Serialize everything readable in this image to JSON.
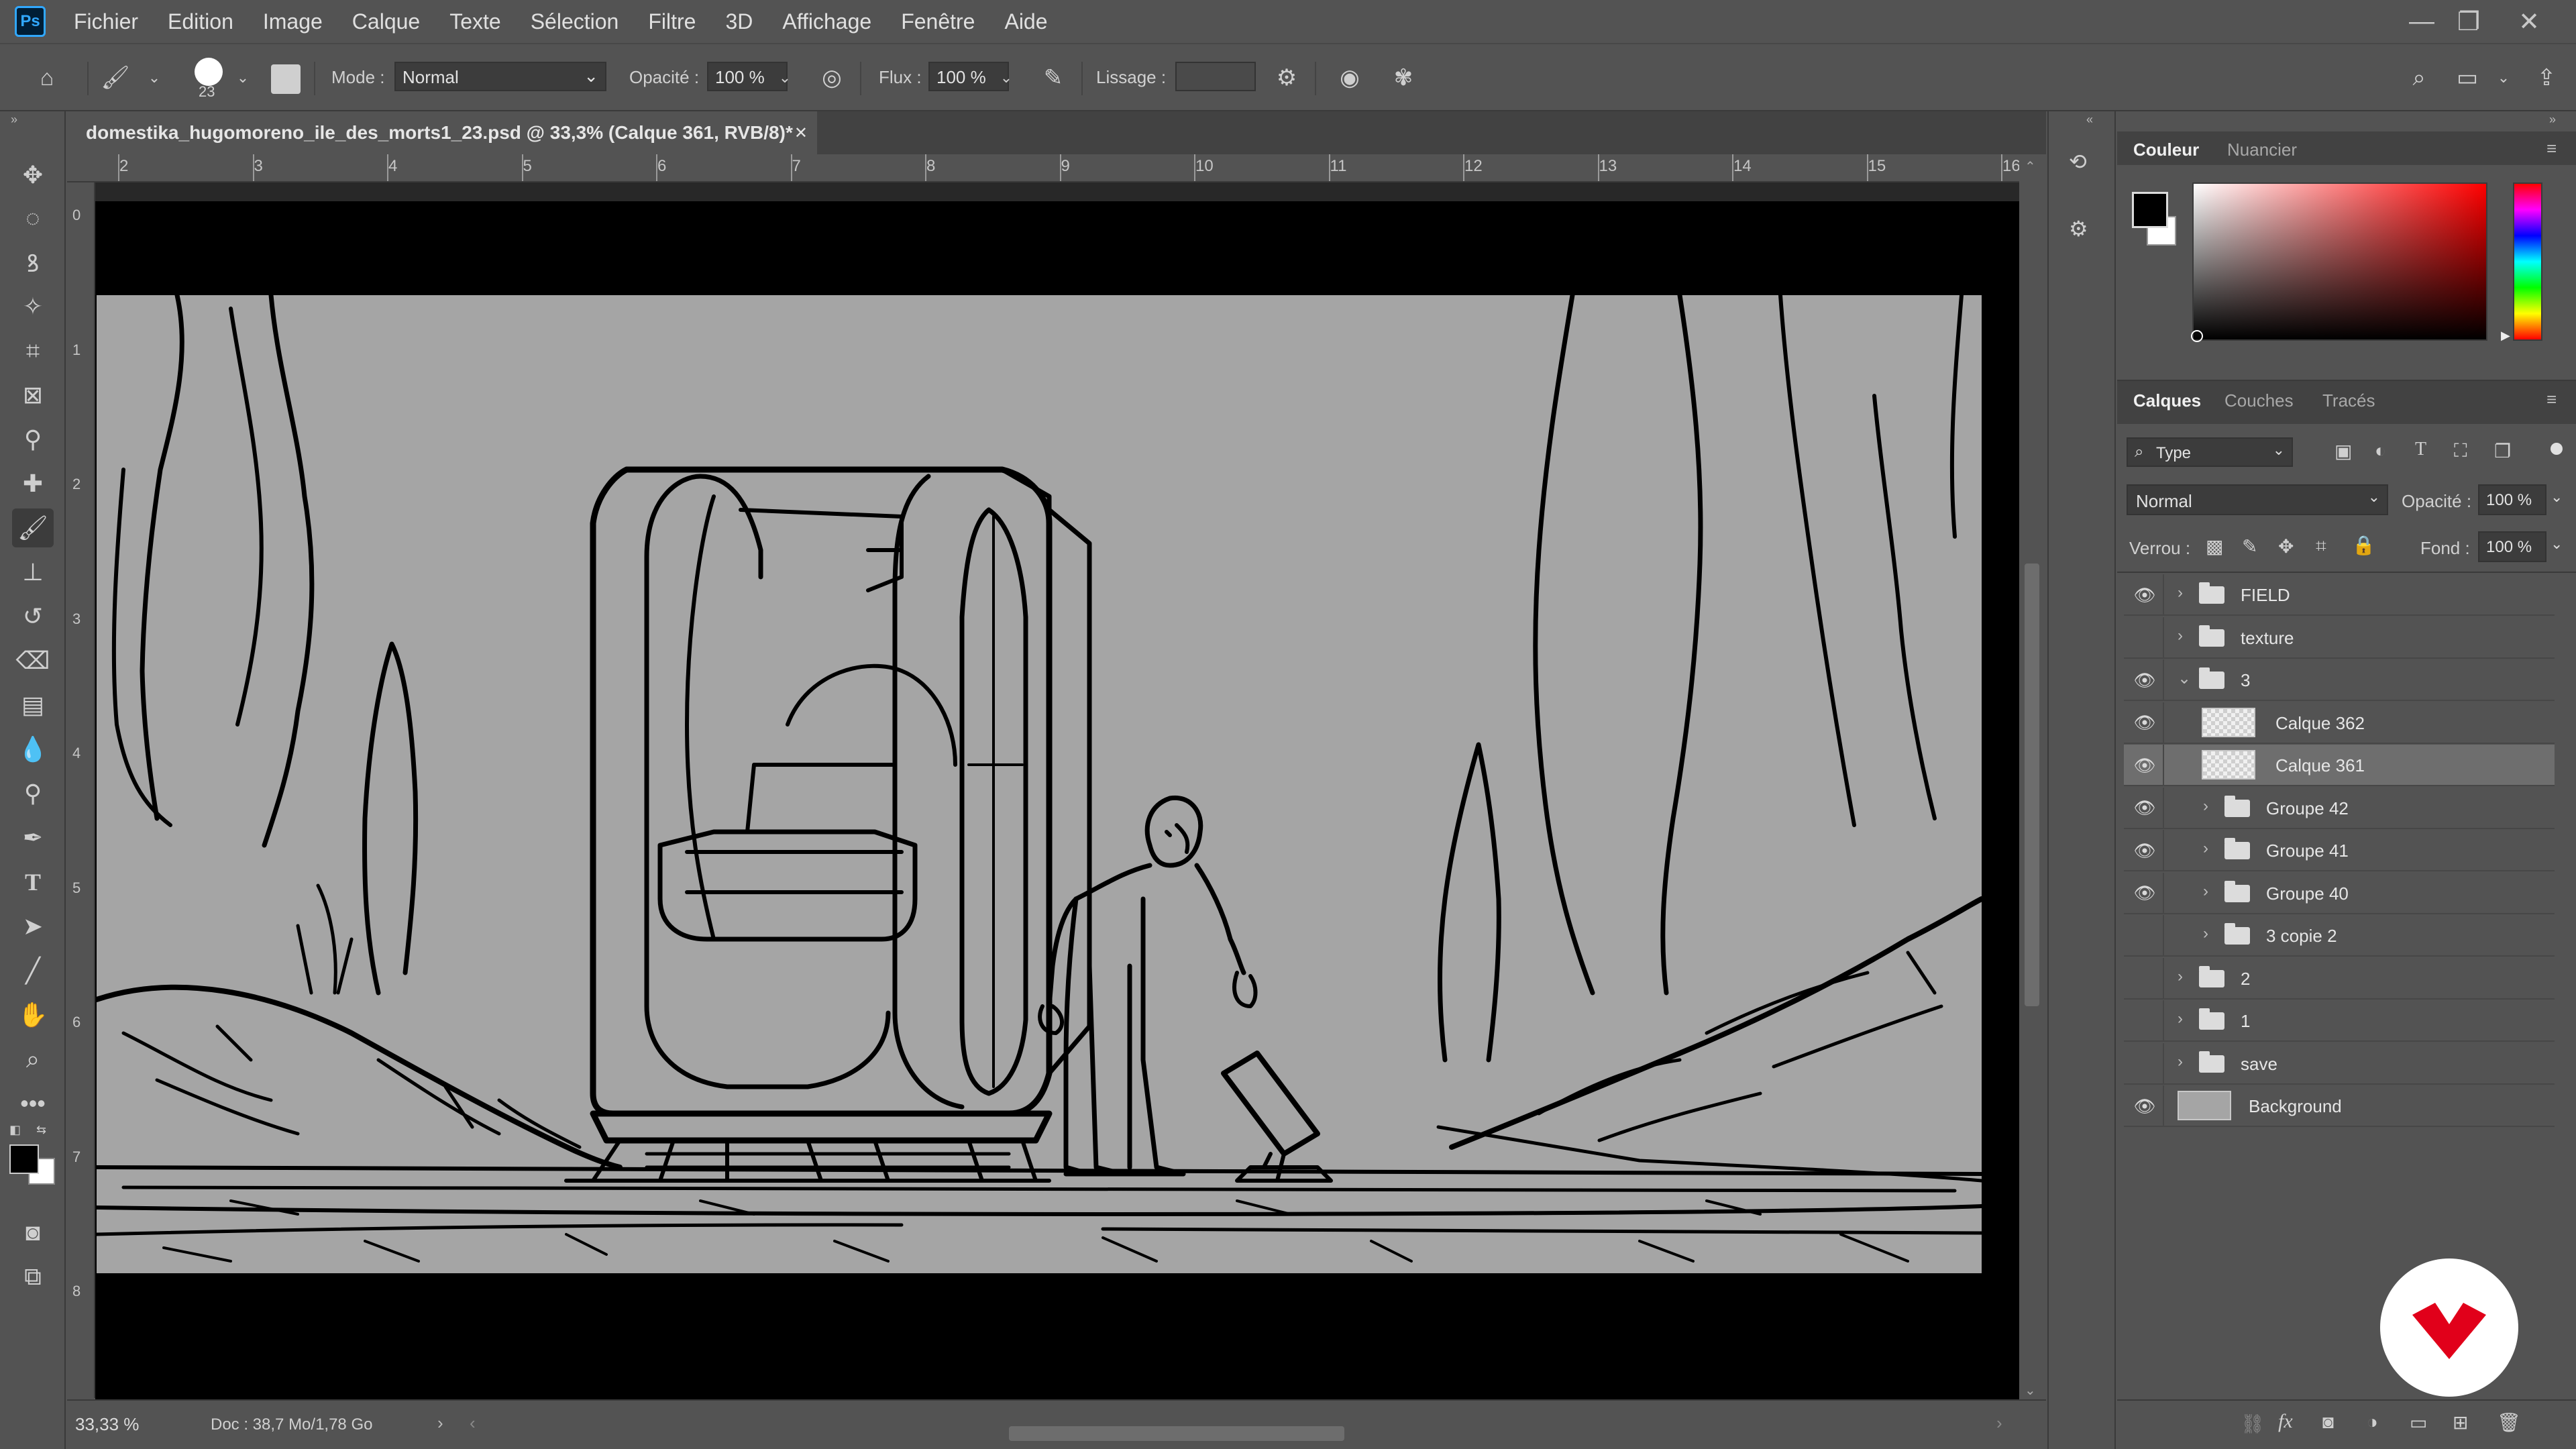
{
  "app": {
    "logo": "Ps",
    "accent": "#31a8ff"
  },
  "menu": [
    "Fichier",
    "Edition",
    "Image",
    "Calque",
    "Texte",
    "Sélection",
    "Filtre",
    "3D",
    "Affichage",
    "Fenêtre",
    "Aide"
  ],
  "window_controls": {
    "minimize": "—",
    "restore": "❐",
    "close": "✕"
  },
  "options": {
    "brush_size": "23",
    "mode_label": "Mode :",
    "mode_value": "Normal",
    "opacity_label": "Opacité :",
    "opacity_value": "100 %",
    "flow_label": "Flux :",
    "flow_value": "100 %",
    "smoothing_label": "Lissage :",
    "smoothing_value": ""
  },
  "document": {
    "tab_title": "domestika_hugomoreno_ile_des_morts1_23.psd @ 33,3% (Calque 361, RVB/8)",
    "modified_marker": "*",
    "zoom": "33,33 %",
    "doc_info": "Doc : 38,7 Mo/1,78 Go"
  },
  "rulers": {
    "horizontal": [
      "2",
      "3",
      "4",
      "5",
      "6",
      "7",
      "8",
      "9",
      "10",
      "11",
      "12",
      "13",
      "14",
      "15",
      "16"
    ],
    "vertical": [
      "0",
      "1",
      "2",
      "3",
      "4",
      "5",
      "6",
      "7",
      "8"
    ]
  },
  "color_panel": {
    "tabs": [
      "Couleur",
      "Nuancier"
    ],
    "foreground": "#000000",
    "background": "#ffffff",
    "hue": "#ff0000"
  },
  "layers_panel": {
    "tabs": [
      "Calques",
      "Couches",
      "Tracés"
    ],
    "filter_label": "Type",
    "blend_mode": "Normal",
    "opacity_label": "Opacité :",
    "opacity_value": "100 %",
    "lock_label": "Verrou :",
    "fill_label": "Fond :",
    "fill_value": "100 %",
    "layers": [
      {
        "name": "FIELD",
        "visible": true,
        "kind": "group",
        "level": 0,
        "expanded": false
      },
      {
        "name": "texture",
        "visible": false,
        "kind": "group",
        "level": 0,
        "expanded": false
      },
      {
        "name": "3",
        "visible": true,
        "kind": "group",
        "level": 0,
        "expanded": true
      },
      {
        "name": "Calque 362",
        "visible": true,
        "kind": "layer",
        "level": 1
      },
      {
        "name": "Calque 361",
        "visible": true,
        "kind": "layer",
        "level": 1,
        "selected": true
      },
      {
        "name": "Groupe 42",
        "visible": true,
        "kind": "group",
        "level": 1,
        "expanded": false
      },
      {
        "name": "Groupe 41",
        "visible": true,
        "kind": "group",
        "level": 1,
        "expanded": false
      },
      {
        "name": "Groupe 40",
        "visible": true,
        "kind": "group",
        "level": 1,
        "expanded": false
      },
      {
        "name": "3 copie 2",
        "visible": false,
        "kind": "group",
        "level": 1,
        "expanded": false
      },
      {
        "name": "2",
        "visible": false,
        "kind": "group",
        "level": 0,
        "expanded": false
      },
      {
        "name": "1",
        "visible": false,
        "kind": "group",
        "level": 0,
        "expanded": false
      },
      {
        "name": "save",
        "visible": false,
        "kind": "group",
        "level": 0,
        "expanded": false
      },
      {
        "name": "Background",
        "visible": true,
        "kind": "background",
        "level": 0
      }
    ]
  }
}
